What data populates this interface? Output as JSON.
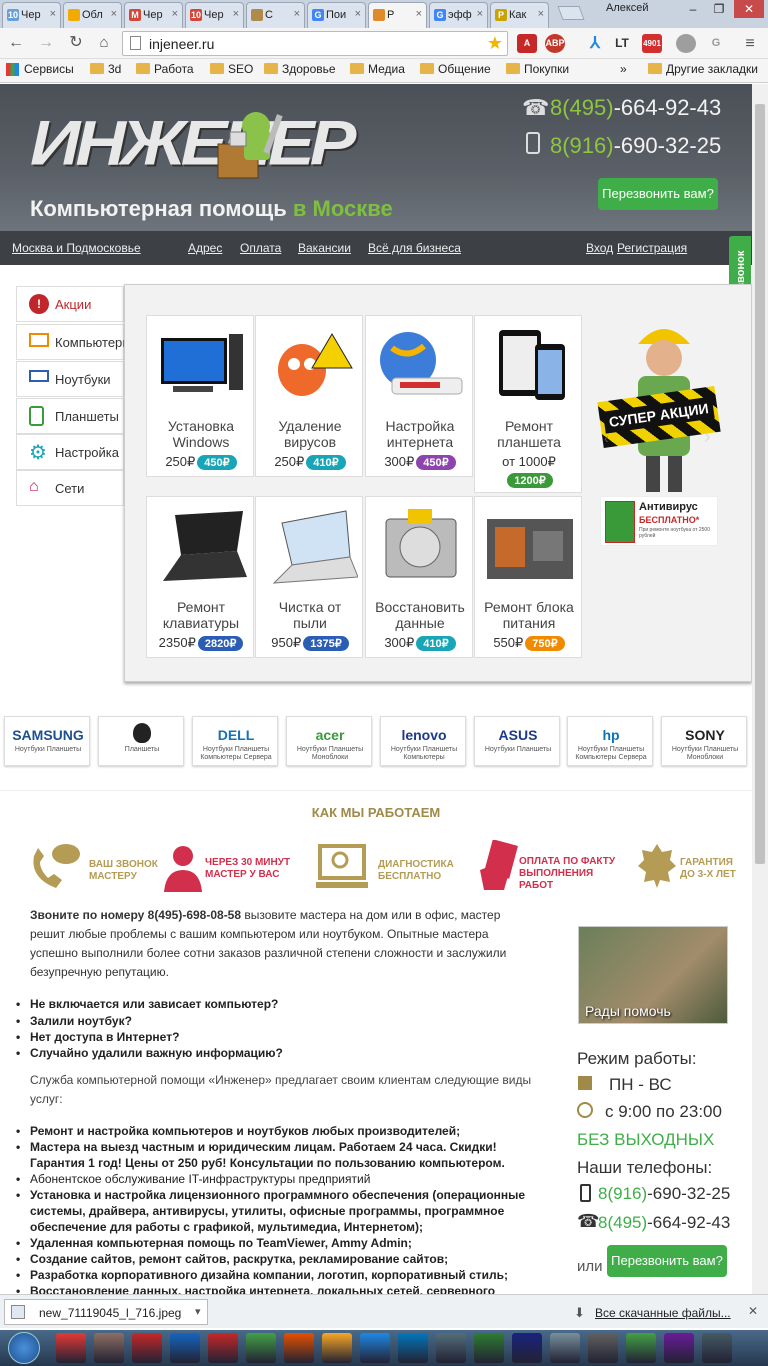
{
  "browser": {
    "tabs": [
      {
        "label": "Чер",
        "fav": "10",
        "color": "#6aa0d8"
      },
      {
        "label": "Обл",
        "fav": "",
        "color": "#f2a900"
      },
      {
        "label": "Чер",
        "fav": "M",
        "color": "#d44638"
      },
      {
        "label": "Чер",
        "fav": "10",
        "color": "#d44638"
      },
      {
        "label": "C",
        "fav": "",
        "color": "#b08a4b"
      },
      {
        "label": "Пои",
        "fav": "G",
        "color": "#4285f4"
      },
      {
        "label": "Р",
        "fav": "",
        "color": "#e08a2a"
      },
      {
        "label": "эфф",
        "fav": "G",
        "color": "#4285f4"
      },
      {
        "label": "Как",
        "fav": "P",
        "color": "#c9a300"
      }
    ],
    "user": "Алексей",
    "url": "injeneer.ru",
    "extensions": [
      "ABP",
      "",
      "",
      "LT",
      "4901",
      "",
      ""
    ],
    "bookmarks": [
      {
        "label": "Сервисы"
      },
      {
        "label": "3d"
      },
      {
        "label": "Работа"
      },
      {
        "label": "SEO"
      },
      {
        "label": "Здоровье"
      },
      {
        "label": "Медиа"
      },
      {
        "label": "Общение"
      },
      {
        "label": "Покупки"
      }
    ],
    "bookmarks_more": "»",
    "other_bookmarks": "Другие закладки"
  },
  "site": {
    "logo": "ИНЖЕНЕР",
    "slogan": "Компьютерная помощь",
    "slogan_city": "в Москве",
    "phone1_prefix": "8(495)",
    "phone1": "-664-92-43",
    "phone2_prefix": "8(916)",
    "phone2": "-690-32-25",
    "callback": "Перезвонить вам?",
    "callback_vertical": "Заказать обратный звонок",
    "nav": [
      "Москва и Подмосковье",
      "Адрес",
      "Оплата",
      "Вакансии",
      "Всё для бизнеса",
      "Вход",
      "Регистрация"
    ],
    "menu": [
      "Акции",
      "Компьютеры",
      "Ноутбуки",
      "Планшеты",
      "Настройка",
      "Сети"
    ],
    "cards": [
      {
        "title1": "Установка",
        "title2": "Windows",
        "old": "250₽",
        "price": "450₽",
        "color": "teal"
      },
      {
        "title1": "Удаление",
        "title2": "вирусов",
        "old": "250₽",
        "price": "410₽",
        "color": "teal"
      },
      {
        "title1": "Настройка",
        "title2": "интернета",
        "old": "300₽",
        "price": "450₽",
        "color": "purple"
      },
      {
        "title1": "Ремонт",
        "title2": "планшета",
        "old": "от 1000₽",
        "price": "1200₽",
        "color": "green"
      },
      {
        "title1": "Ремонт",
        "title2": "клавиатуры",
        "old": "2350₽",
        "price": "2820₽",
        "color": "blue"
      },
      {
        "title1": "Чистка от",
        "title2": "пыли",
        "old": "950₽",
        "price": "1375₽",
        "color": "blue"
      },
      {
        "title1": "Восстановить",
        "title2": "данные",
        "old": "300₽",
        "price": "410₽",
        "color": "teal"
      },
      {
        "title1": "Ремонт блока",
        "title2": "питания",
        "old": "550₽",
        "price": "750₽",
        "color": "orange"
      }
    ],
    "promo_banner": "СУПЕР АКЦИИ",
    "antivirus_title": "Антивирус",
    "antivirus_free": "БЕСПЛАТНО*",
    "antivirus_note": "При ремонте ноутбука от 2500 рублей",
    "brands": [
      {
        "name": "SAMSUNG",
        "sub": "Ноутбуки Планшеты"
      },
      {
        "name": "",
        "sub": "Планшеты"
      },
      {
        "name": "DELL",
        "sub": "Ноутбуки Планшеты Компьютеры Сервера"
      },
      {
        "name": "acer",
        "sub": "Ноутбуки Планшеты Моноблоки"
      },
      {
        "name": "lenovo",
        "sub": "Ноутбуки Планшеты Компьютеры"
      },
      {
        "name": "ASUS",
        "sub": "Ноутбуки Планшеты"
      },
      {
        "name": "hp",
        "sub": "Ноутбуки Планшеты Компьютеры Сервера"
      },
      {
        "name": "SONY",
        "sub": "Ноутбуки Планшеты Моноблоки"
      }
    ],
    "how_title": "КАК МЫ РАБОТАЕМ",
    "how": [
      {
        "l1": "ВАШ ЗВОНОК",
        "l2": "МАСТЕРУ",
        "l3": ""
      },
      {
        "l1": "ЧЕРЕЗ 30 МИНУТ",
        "l2": "МАСТЕР У ВАС",
        "l3": ""
      },
      {
        "l1": "ДИАГНОСТИКА",
        "l2": "БЕСПЛАТНО",
        "l3": ""
      },
      {
        "l1": "ОПЛАТА ПО ФАКТУ",
        "l2": "ВЫПОЛНЕНИЯ",
        "l3": "РАБОТ"
      },
      {
        "l1": "ГАРАНТИЯ",
        "l2": "ДО 3-Х ЛЕТ",
        "l3": ""
      }
    ],
    "intro_bold": "Звоните по номеру 8(495)-698-08-58",
    "intro": " вызовите мастера на дом или в офис, мастер решит любые проблемы с вашим компьютером или ноутбуком. Опытные мастера успешно выполнили более сотни заказов различной степени сложности и заслужили безупречную репутацию.",
    "problems": [
      "Не включается или зависает компьютер?",
      "Залили ноутбук?",
      "Нет доступа в Интернет?",
      "Случайно удалили важную информацию?"
    ],
    "services_intro": "Служба компьютерной помощи «Инженер» предлагает своим клиентам следующие виды услуг:",
    "services": [
      {
        "t": "Ремонт и настройка компьютеров и ноутбуков любых производителей;",
        "b": true
      },
      {
        "t": "Мастера на выезд частным и юридическим лицам. Работаем 24 часа. Скидки! Гарантия 1 год! Цены от 250 руб! Консультации по пользованию компьютером.",
        "b": true
      },
      {
        "t": "Абонентское обслуживание IT-инфраструктуры предприятий",
        "b": false
      },
      {
        "t": "Установка и настройка лицензионного программного обеспечения (операционные системы, драйвера, антивирусы, утилиты, офисные программы, программное обеспечение для работы с графикой, мультимедиа, Интернетом);",
        "b": true
      },
      {
        "t": "Удаленная компьютерная помощь по TeamViewer, Ammy Admin;",
        "b": true
      },
      {
        "t": "Создание сайтов, ремонт сайтов, раскрутка, рекламирование сайтов;",
        "b": true
      },
      {
        "t": "Разработка корпоративного дизайна компании, логотип, корпоративный стиль;",
        "b": true
      },
      {
        "t": "Восстановление данных, настройка интернета, локальных сетей, серверного",
        "b": true
      }
    ],
    "photo_caption": "Рады помочь",
    "hours_title": "Режим работы:",
    "days": "ПН - ВС",
    "hours": "с 9:00 по 23:00",
    "no_weekends": "БЕЗ ВЫХОДНЫХ",
    "phones_title": "Наши телефоны:",
    "side_phone1_prefix": "8(916)",
    "side_phone1": "-690-32-25",
    "side_phone2_prefix": "8(495)",
    "side_phone2": "-664-92-43",
    "or": "или"
  },
  "downloads": {
    "file": "new_71119045_l_716.jpeg",
    "all": "Все скачанные файлы..."
  }
}
